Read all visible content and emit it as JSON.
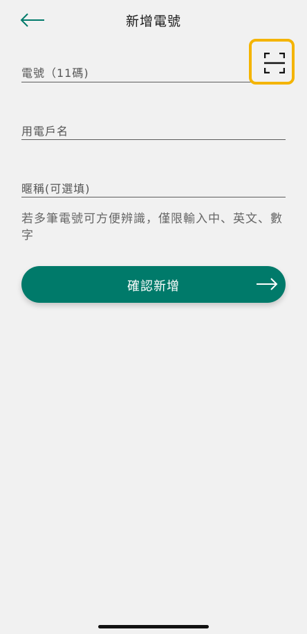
{
  "header": {
    "title": "新增電號",
    "back_icon": "arrow-left-icon"
  },
  "form": {
    "phone_label": "電號（11碼)",
    "name_label": "用電戶名",
    "nickname_label": "暱稱(可選填)",
    "scan_icon": "scan-icon",
    "hint": "若多筆電號可方便辨識，僅限輸入中、英文、數字"
  },
  "actions": {
    "confirm_label": "確認新增",
    "confirm_icon": "arrow-right-icon"
  },
  "colors": {
    "accent": "#007a6a",
    "highlight": "#f4b400",
    "background": "#f1f1f1"
  }
}
